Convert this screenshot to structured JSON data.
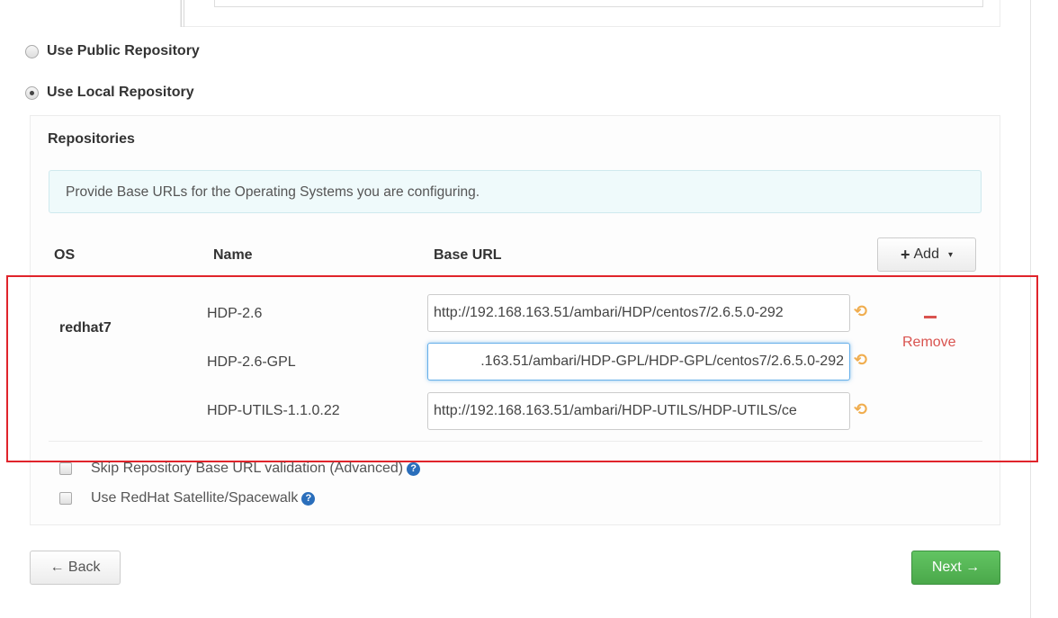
{
  "repo_options": {
    "public_label": "Use Public Repository",
    "local_label": "Use Local Repository"
  },
  "repositories": {
    "title": "Repositories",
    "info_text": "Provide Base URLs for the Operating Systems you are configuring.",
    "columns": {
      "os": "OS",
      "name": "Name",
      "base_url": "Base URL"
    },
    "add_button": {
      "symbol": "+",
      "label": "Add",
      "caret": "▾"
    },
    "os_group": {
      "os": "redhat7",
      "rows": [
        {
          "name": "HDP-2.6",
          "url_display": "http://192.168.163.51/ambari/HDP/centos7/2.6.5.0-292"
        },
        {
          "name": "HDP-2.6-GPL",
          "url_display": ".163.51/ambari/HDP-GPL/HDP-GPL/centos7/2.6.5.0-292"
        },
        {
          "name": "HDP-UTILS-1.1.0.22",
          "url_display": "http://192.168.163.51/ambari/HDP-UTILS/HDP-UTILS/ce"
        }
      ],
      "remove_symbol": "–",
      "remove_label": "Remove"
    }
  },
  "options": {
    "skip_validation": "Skip Repository Base URL validation (Advanced)",
    "use_satellite": "Use RedHat Satellite/Spacewalk",
    "help_glyph": "?"
  },
  "nav": {
    "back_label": "← Back",
    "next_label": "Next →"
  },
  "colors": {
    "highlight": "#e0242b",
    "remove": "#d9534f",
    "next": "#5cb85c",
    "info_bg": "#effafb"
  }
}
